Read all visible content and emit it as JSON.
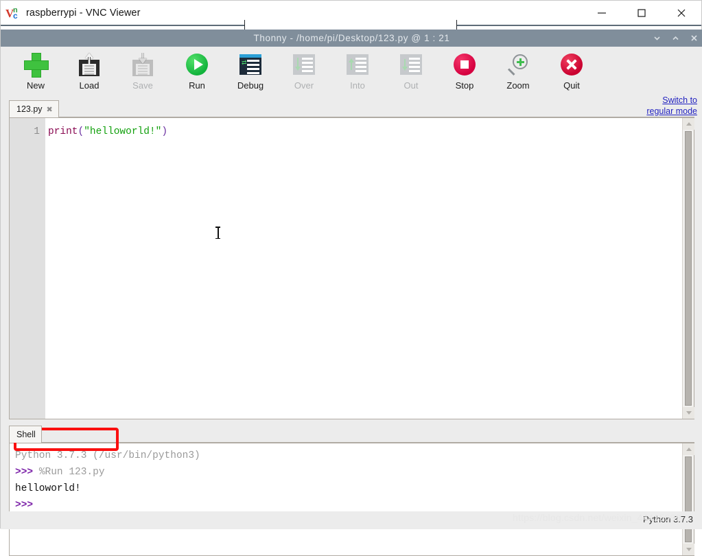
{
  "vnc": {
    "title": "raspberrypi - VNC Viewer",
    "logo_v": "V",
    "logo_n": "n",
    "logo_c": "c",
    "window_buttons": [
      {
        "name": "minimize",
        "glyph": "minimize-icon"
      },
      {
        "name": "maximize",
        "glyph": "maximize-icon"
      },
      {
        "name": "close",
        "glyph": "close-icon"
      }
    ]
  },
  "thonny": {
    "title": "Thonny  -  /home/pi/Desktop/123.py  @  1 : 21",
    "titlebar_color": "#808e9b",
    "window_buttons": [
      {
        "name": "collapse",
        "glyph": "chevron-down-icon"
      },
      {
        "name": "expand",
        "glyph": "chevron-up-icon"
      },
      {
        "name": "close",
        "glyph": "close-icon"
      }
    ]
  },
  "toolbar": {
    "items": [
      {
        "label": "New",
        "icon": "new-plus-icon",
        "enabled": true
      },
      {
        "label": "Load",
        "icon": "load-disk-icon",
        "enabled": true
      },
      {
        "label": "Save",
        "icon": "save-disk-icon",
        "enabled": false
      },
      {
        "label": "Run",
        "icon": "run-play-icon",
        "enabled": true
      },
      {
        "label": "Debug",
        "icon": "debug-icon",
        "enabled": true
      },
      {
        "label": "Over",
        "icon": "step-over-icon",
        "enabled": false
      },
      {
        "label": "Into",
        "icon": "step-into-icon",
        "enabled": false
      },
      {
        "label": "Out",
        "icon": "step-out-icon",
        "enabled": false
      },
      {
        "label": "Stop",
        "icon": "stop-icon",
        "enabled": true
      },
      {
        "label": "Zoom",
        "icon": "zoom-icon",
        "enabled": true
      },
      {
        "label": "Quit",
        "icon": "quit-icon",
        "enabled": true
      }
    ],
    "switch_mode_link": "Switch to regular mode",
    "switch_mode_color": "#1f1fbf"
  },
  "editor": {
    "tab": {
      "label": "123.py",
      "close_glyph": "✖"
    },
    "line_numbers": [
      "1"
    ],
    "code": {
      "fn": "print",
      "open_paren": "(",
      "string": "\"helloworld!\"",
      "close_paren": ")"
    },
    "colors": {
      "function": "#8a0a52",
      "paren": "#6a2fa0",
      "string": "#13a10e"
    }
  },
  "shell": {
    "tab": {
      "label": "Shell"
    },
    "lines": [
      {
        "kind": "sys",
        "text": "Python 3.7.3 (/usr/bin/python3)"
      },
      {
        "kind": "prompt",
        "text": ">>> ",
        "cmd": "%Run 123.py"
      },
      {
        "kind": "out",
        "text": "helloworld!"
      },
      {
        "kind": "prompt",
        "text": ">>> ",
        "cmd": ""
      }
    ],
    "annotation": {
      "shape": "rectangle",
      "color": "#fa0f0f",
      "target": "helloworld!"
    }
  },
  "statusbar": {
    "interpreter": "Python 3.7.3"
  },
  "watermark": {
    "text": "https://blog.csdn.net/weixin_44415699"
  }
}
